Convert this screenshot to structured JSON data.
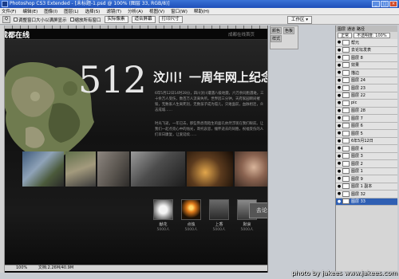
{
  "window": {
    "title": "Photoshop CS3 Extended - [未标题-1.psd @ 100% (图层 33, RGB/8)]",
    "minimize": "_",
    "maximize": "□",
    "close": "×"
  },
  "menu": [
    "文件(F)",
    "编辑(E)",
    "图像(I)",
    "图层(L)",
    "选择(S)",
    "滤镜(T)",
    "分析(A)",
    "视图(V)",
    "窗口(W)",
    "帮助(H)"
  ],
  "options": {
    "zoom_icon": "Q",
    "check1": "调整窗口大小以满屏显示",
    "check2": "缩放所有窗口",
    "btn_actual": "实际像素",
    "btn_fit": "适合屏幕",
    "btn_print": "打印尺寸",
    "workspace": "工作区 ▾"
  },
  "canvas": {
    "site_logo": "成都在线",
    "site_link": "成都在线首页",
    "big_number": "512",
    "headline": "汶川！一周年网上纪念堂",
    "para1": "6年5月12日14时28分，四川汶川遭遇八级地震，六万余同胞遇难，三十余万人受伤，数百万人流离失所。世界因三分钟，天府家园瞬间摧毁，无数家人生离死别，无数孩子成为孤儿，灾难面前，血脉相连，众志成城……",
    "para2": "时光飞逝，一年已去，那些熟悉而陌生的面孔依然浮现在我们眼前。让我们一起点亮心中的烛光，寄托哀思，缅怀逝去的同胞，祝福受伤的人们早日康复，让爱延续……",
    "actions": [
      {
        "label": "献花",
        "count": "5000人"
      },
      {
        "label": "点烛",
        "count": "5000人"
      },
      {
        "label": "上香",
        "count": "5000人"
      },
      {
        "label": "默哀",
        "count": "5000人"
      }
    ],
    "discuss_button": "去论坛发表留言"
  },
  "status": {
    "zoom": "100%",
    "doc": "文档:2.26M/40.9M"
  },
  "midpanel": {
    "tab1": "颜色",
    "tab2": "色板",
    "tab3": "样式"
  },
  "layers": {
    "tabs": [
      "图层",
      "通道",
      "路径"
    ],
    "mode": "正常",
    "opacity": "不透明度: 100%",
    "rows": [
      {
        "name": "帮元",
        "selected": false
      },
      {
        "name": "去论坛发表",
        "selected": false
      },
      {
        "name": "图层 8",
        "selected": false
      },
      {
        "name": "效果",
        "selected": false
      },
      {
        "name": "描边",
        "selected": false
      },
      {
        "name": "图层 24",
        "selected": false
      },
      {
        "name": "图层 23",
        "selected": false
      },
      {
        "name": "图层 22",
        "selected": false
      },
      {
        "name": "pic",
        "selected": false
      },
      {
        "name": "图层 28",
        "selected": false
      },
      {
        "name": "图层 7",
        "selected": false
      },
      {
        "name": "图层 6",
        "selected": false
      },
      {
        "name": "图层 5",
        "selected": false
      },
      {
        "name": "6年5月12日",
        "selected": false
      },
      {
        "name": "图层 4",
        "selected": false
      },
      {
        "name": "图层 3",
        "selected": false
      },
      {
        "name": "图层 2",
        "selected": false
      },
      {
        "name": "图层 1",
        "selected": false
      },
      {
        "name": "图层 9",
        "selected": false
      },
      {
        "name": "图层 1 副本",
        "selected": false
      },
      {
        "name": "图层 32",
        "selected": false
      },
      {
        "name": "图层 33",
        "selected": true
      }
    ]
  },
  "watermark": "photo by jakees  www.jakees.com"
}
